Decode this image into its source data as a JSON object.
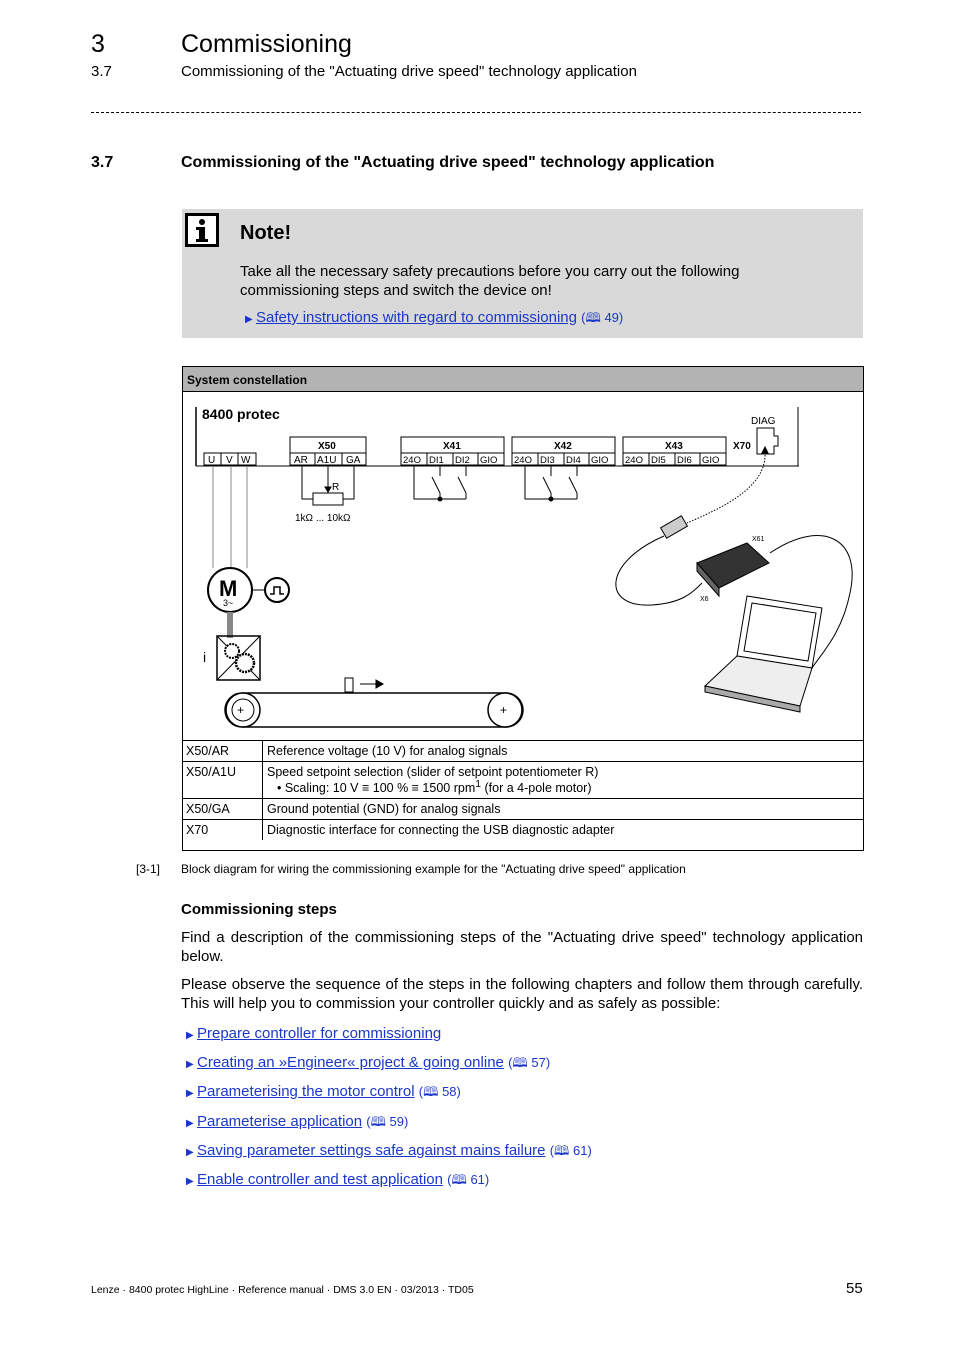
{
  "header": {
    "chapter_number": "3",
    "chapter_title": "Commissioning",
    "section_number": "3.7",
    "section_title": "Commissioning of the \"Actuating drive speed\" technology application"
  },
  "heading": {
    "number": "3.7",
    "title": "Commissioning of the \"Actuating drive speed\" technology application"
  },
  "note": {
    "icon": "info-icon",
    "title": "Note!",
    "text": "Take all the necessary safety precautions before you carry out the following commissioning steps and switch the device on!",
    "link": "Safety instructions with regard to commissioning",
    "page_ref": "49"
  },
  "figure": {
    "title": "System constellation",
    "diagram": {
      "device": "8400 protec",
      "diag": "DIAG",
      "x70": "X70",
      "uvw": [
        "U",
        "V",
        "W"
      ],
      "x50": {
        "name": "X50",
        "pins": [
          "AR",
          "A1U",
          "GA"
        ]
      },
      "x41": {
        "name": "X41",
        "pins": [
          "24O",
          "DI1",
          "DI2",
          "GIO"
        ]
      },
      "x42": {
        "name": "X42",
        "pins": [
          "24O",
          "DI3",
          "DI4",
          "GIO"
        ]
      },
      "x43": {
        "name": "X43",
        "pins": [
          "24O",
          "DI5",
          "DI6",
          "GIO"
        ]
      },
      "r": "R",
      "range": "1kΩ ... 10kΩ",
      "motor": "M",
      "motor_sub": "3~",
      "i": "i",
      "x61": "X61",
      "x6": "X6"
    },
    "legend": [
      {
        "term": "X50/AR",
        "desc": "Reference voltage (10 V) for analog signals"
      },
      {
        "term": "X50/A1U",
        "desc": "Speed setpoint selection (slider of setpoint potentiometer R)",
        "bullet": "• Scaling: 10 V ≡ 100 % ≡ 1500 rpm",
        "sup": "1",
        "bullet_end": " (for a 4-pole motor)"
      },
      {
        "term": "X50/GA",
        "desc": "Ground potential (GND) for analog signals"
      },
      {
        "term": "X70",
        "desc": "Diagnostic interface for connecting the USB diagnostic adapter"
      }
    ],
    "caption_number": "[3-1]",
    "caption": "Block diagram for wiring the commissioning example for the \"Actuating drive speed\" application"
  },
  "steps": {
    "title": "Commissioning steps",
    "para1": "Find a description of the commissioning steps of the \"Actuating drive speed\" technology application below.",
    "para2": "Please observe the sequence of the steps in the following chapters and follow them through carefully. This will help you to commission your controller quickly and as safely as possible:",
    "links": [
      {
        "label": "Prepare controller for commissioning",
        "page": ""
      },
      {
        "label": "Creating an »Engineer« project & going online",
        "page": "57"
      },
      {
        "label": "Parameterising the motor control",
        "page": "58"
      },
      {
        "label": "Parameterise application",
        "page": "59"
      },
      {
        "label": "Saving parameter settings safe against mains failure",
        "page": "61"
      },
      {
        "label": "Enable controller and test application",
        "page": "61"
      }
    ]
  },
  "footer": {
    "text": "Lenze · 8400 protec HighLine · Reference manual · DMS 3.0 EN · 03/2013 · TD05",
    "page": "55"
  },
  "colors": {
    "link": "#1a37c9",
    "note_bg": "#d9d9d9",
    "figure_header": "#b3b3b3"
  }
}
